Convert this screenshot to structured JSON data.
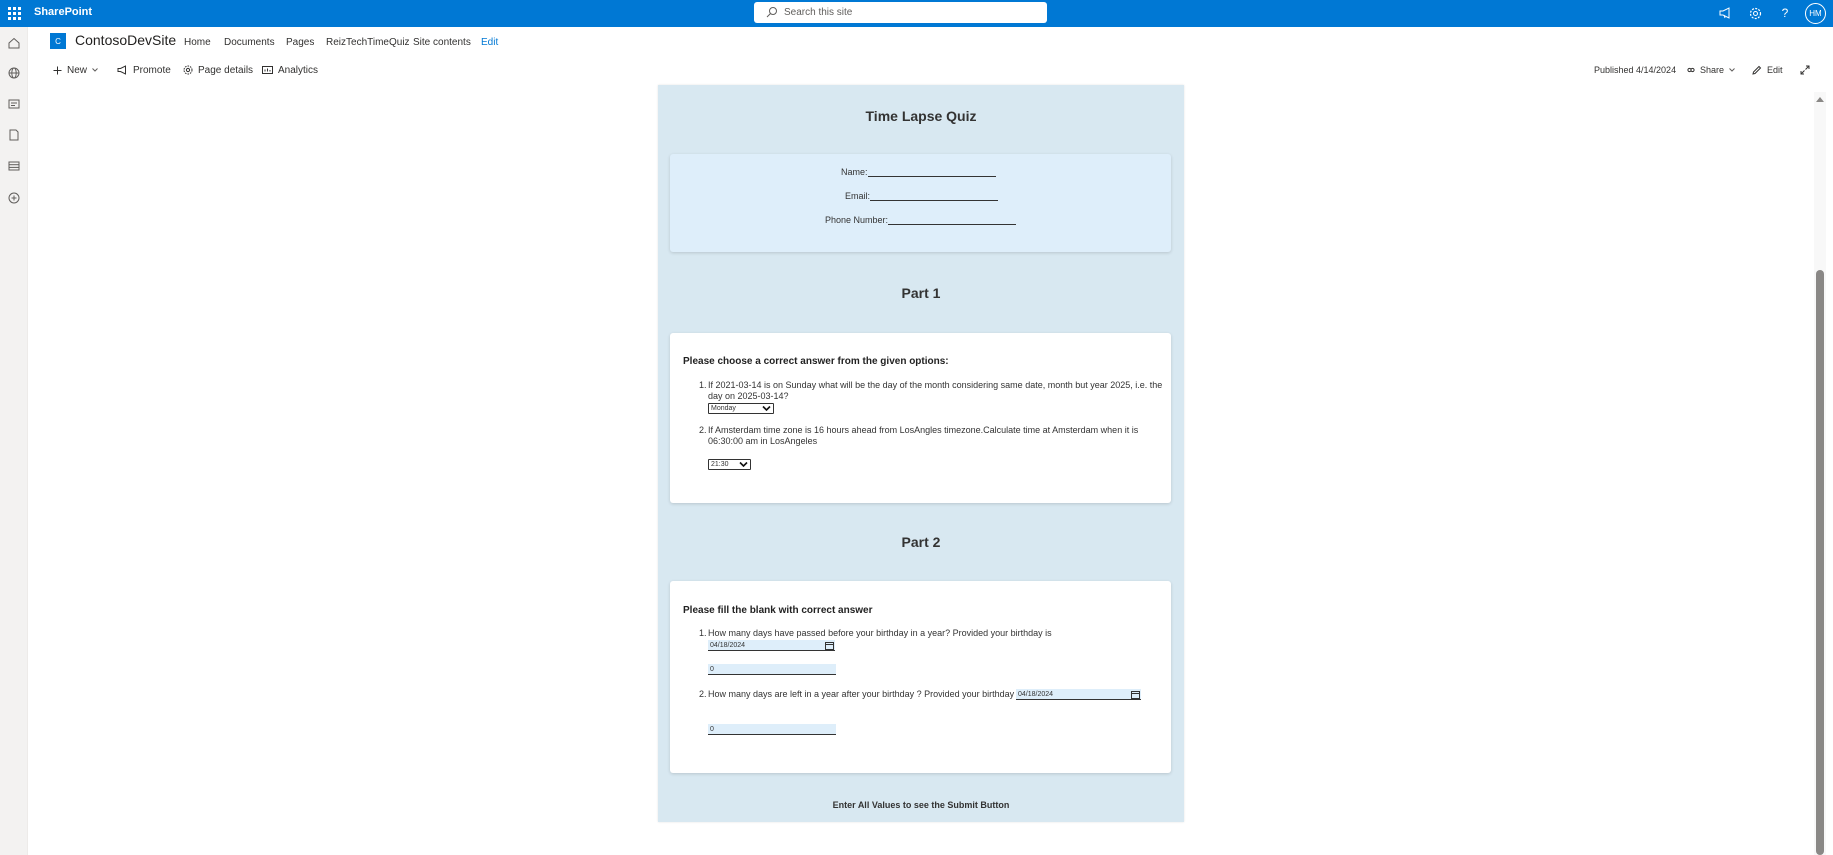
{
  "suite": {
    "brand": "SharePoint",
    "search_placeholder": "Search this site",
    "avatar_initials": "HM"
  },
  "site": {
    "logo_letter": "C",
    "title": "ContosoDevSite",
    "nav": [
      "Home",
      "Documents",
      "Pages",
      "ReizTechTimeQuiz",
      "Site contents",
      "Edit"
    ]
  },
  "commandbar": {
    "new": "New",
    "promote": "Promote",
    "page_details": "Page details",
    "analytics": "Analytics",
    "published": "Published 4/14/2024",
    "share": "Share",
    "edit": "Edit"
  },
  "quiz": {
    "title": "Time Lapse Quiz",
    "fields": {
      "name_label": "Name:",
      "email_label": "Email:",
      "phone_label": "Phone Number:"
    },
    "part1": {
      "title": "Part 1",
      "heading": "Please choose a correct answer from the given options:",
      "q1_num": "1.",
      "q1_line1": "If 2021-03-14 is on Sunday what will be the day of the month considering same date, month but year 2025, i.e. the",
      "q1_line2": "day on 2025-03-14?",
      "q1_selected": "Monday",
      "q2_num": "2.",
      "q2_line1": "If Amsterdam time zone is 16 hours ahead from LosAngles timezone.Calculate time at Amsterdam when it is",
      "q2_line2": "06:30:00 am in LosAngeles",
      "q2_selected": "21:30"
    },
    "part2": {
      "title": "Part 2",
      "heading": "Please fill the blank with correct answer",
      "q1_num": "1.",
      "q1_text": "How many days have passed before your birthday in a year? Provided your birthday is",
      "q1_date": "04/18/2024",
      "q1_value": "0",
      "q2_num": "2.",
      "q2_text": "How many days are left in a year after your birthday ? Provided your birthday is",
      "q2_date": "04/18/2024",
      "q2_value": "0"
    },
    "footer": "Enter All Values to see the Submit Button"
  },
  "colors": {
    "suite_blue": "#0078d4",
    "quiz_bg": "#d8e8f1",
    "card_tint": "#deeefa"
  },
  "icons": [
    "waffle-icon",
    "search-icon",
    "megaphone-icon",
    "gear-icon",
    "help-icon",
    "home-icon",
    "globe-icon",
    "news-icon",
    "file-icon",
    "list-icon",
    "add-circle-icon",
    "plus-icon",
    "chevron-down-icon",
    "promote-icon",
    "settings-icon",
    "analytics-icon",
    "share-icon",
    "pencil-icon",
    "expand-icon",
    "calendar-icon"
  ]
}
